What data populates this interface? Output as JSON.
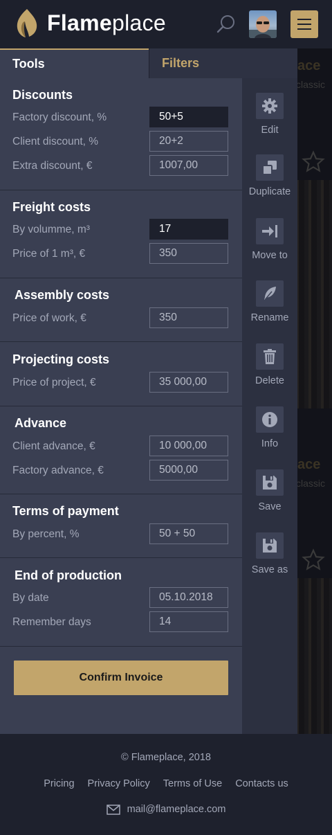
{
  "brand": {
    "name_bold": "Flame",
    "name_light": "place"
  },
  "tabs": [
    {
      "label": "Tools"
    },
    {
      "label": "Filters"
    }
  ],
  "background": {
    "ghost_text": "ace",
    "ghost_sub": "classic"
  },
  "sections": {
    "discounts": {
      "title": "Discounts",
      "rows": [
        {
          "label": "Factory discount, %",
          "value": "50+5"
        },
        {
          "label": "Client discount, %",
          "value": "20+2"
        },
        {
          "label": "Extra discount, €",
          "value": "1007,00"
        }
      ]
    },
    "freight": {
      "title": "Freight costs",
      "rows": [
        {
          "label": "By volumme, m³",
          "value": "17"
        },
        {
          "label": "Price of 1 m³, €",
          "value": "350"
        }
      ]
    },
    "assembly": {
      "title": "Assembly costs",
      "rows": [
        {
          "label": "Price of work, €",
          "value": "350"
        }
      ]
    },
    "projecting": {
      "title": "Projecting costs",
      "rows": [
        {
          "label": "Price of project, €",
          "value": "35 000,00"
        }
      ]
    },
    "advance": {
      "title": "Advance",
      "rows": [
        {
          "label": "Client advance, €",
          "value": "10 000,00"
        },
        {
          "label": "Factory advance, €",
          "value": "5000,00"
        }
      ]
    },
    "terms": {
      "title": "Terms of payment",
      "rows": [
        {
          "label": "By percent, %",
          "value": "50 + 50"
        }
      ]
    },
    "production": {
      "title": "End of production",
      "rows": [
        {
          "label": "By date",
          "value": "05.10.2018"
        },
        {
          "label": "Remember days",
          "value": "14"
        }
      ]
    }
  },
  "confirm_label": "Confirm Invoice",
  "tools": [
    {
      "label": "Edit",
      "icon": "gear-icon"
    },
    {
      "label": "Duplicate",
      "icon": "duplicate-icon"
    },
    {
      "label": "Move to",
      "icon": "move-to-icon"
    },
    {
      "label": "Rename",
      "icon": "feather-icon"
    },
    {
      "label": "Delete",
      "icon": "trash-icon"
    },
    {
      "label": "Info",
      "icon": "info-icon"
    },
    {
      "label": "Save",
      "icon": "floppy-icon"
    },
    {
      "label": "Save as",
      "icon": "floppy-icon"
    }
  ],
  "footer": {
    "copyright": "© Flameplace, 2018",
    "links": [
      "Pricing",
      "Privacy Policy",
      "Terms of Use",
      "Contacts us"
    ],
    "email": "mail@flameplace.com"
  },
  "colors": {
    "accent": "#c2a56b",
    "panel": "#3a3f52",
    "header": "#1d202c",
    "tool_column": "#2c3040"
  }
}
